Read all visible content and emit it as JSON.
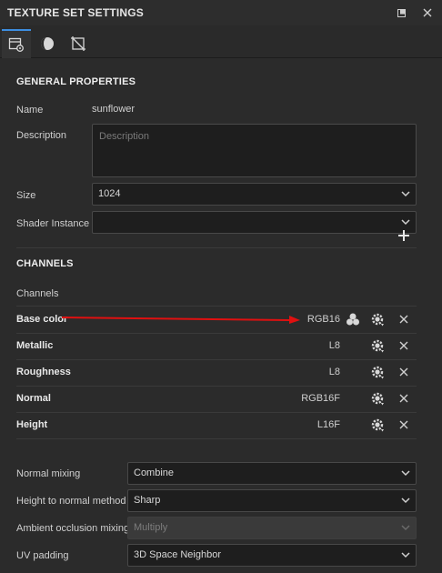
{
  "window": {
    "title": "TEXTURE SET SETTINGS"
  },
  "tabs": [
    {
      "icon": "texture-set-settings-icon",
      "active": true
    },
    {
      "icon": "material-sphere-icon",
      "active": false
    },
    {
      "icon": "crop-frame-icon",
      "active": false
    }
  ],
  "general": {
    "heading": "GENERAL PROPERTIES",
    "name_label": "Name",
    "name_value": "sunflower",
    "description_label": "Description",
    "description_placeholder": "Description",
    "size_label": "Size",
    "size_value": "1024",
    "shader_label": "Shader Instance",
    "shader_value": ""
  },
  "channels": {
    "heading": "CHANNELS",
    "list_label": "Channels",
    "items": [
      {
        "name": "Base color",
        "format": "RGB16"
      },
      {
        "name": "Metallic",
        "format": "L8"
      },
      {
        "name": "Roughness",
        "format": "L8"
      },
      {
        "name": "Normal",
        "format": "RGB16F"
      },
      {
        "name": "Height",
        "format": "L16F"
      }
    ]
  },
  "settings": {
    "normal_mixing_label": "Normal mixing",
    "normal_mixing_value": "Combine",
    "height_to_normal_label": "Height to normal method",
    "height_to_normal_value": "Sharp",
    "ao_mixing_label": "Ambient occlusion mixing",
    "ao_mixing_value": "Multiply",
    "uv_padding_label": "UV padding",
    "uv_padding_value": "3D Space Neighbor"
  },
  "colors": {
    "accent": "#3d8ee0",
    "annotation_arrow": "#e01010"
  }
}
